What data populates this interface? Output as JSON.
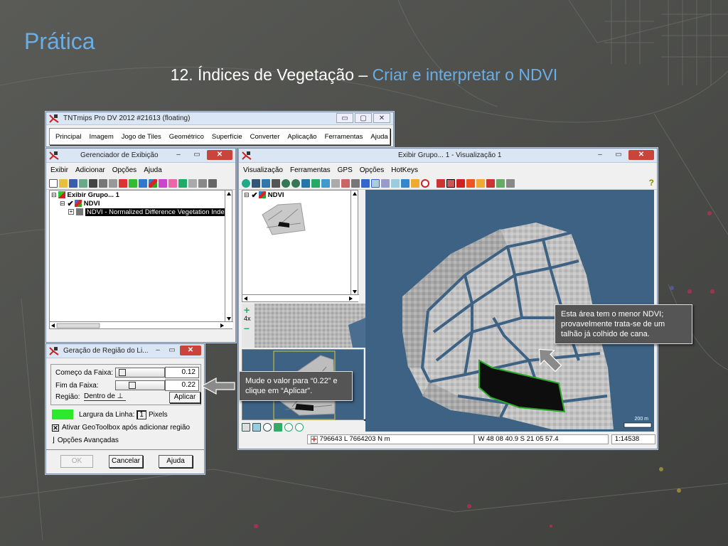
{
  "slide": {
    "title": "Prática",
    "subtitle_prefix": "12. Índices de Vegetação – ",
    "subtitle_accent": "Criar e interpretar o NDVI"
  },
  "tnt_window": {
    "title": "TNTmips Pro DV 2012  #21613 (floating)",
    "menu": [
      "Principal",
      "Imagem",
      "Jogo de Tiles",
      "Geométrico",
      "Superfície",
      "Converter",
      "Aplicação",
      "Ferramentas",
      "Ajuda"
    ]
  },
  "display_manager": {
    "title": "Gerenciador de Exibição",
    "menu": [
      "Exibir",
      "Adicionar",
      "Opções",
      "Ajuda"
    ],
    "tree": {
      "group": "Exibir Grupo... 1",
      "layer": "NDVI",
      "sublayer": "NDVI - Normalized Difference Vegetation Index"
    }
  },
  "view_window": {
    "title": "Exibir Grupo... 1 - Visualização 1",
    "menu": [
      "Visualização",
      "Ferramentas",
      "GPS",
      "Opções",
      "HotKeys"
    ],
    "legend_layer": "NDVI",
    "zoom_label": "4x",
    "scale_bar": "200 m",
    "status": {
      "coords": "796643 L  7664203 N m",
      "latlon": "W 48 08 40.9  S 21 05 57.4",
      "scale": "1:14538"
    }
  },
  "region_dialog": {
    "title": "Geração de Região do Li...",
    "start_label": "Começo da Faixa:",
    "start_value": "0.12",
    "end_label": "Fim da Faixa:",
    "end_value": "0.22",
    "region_label": "Região:",
    "region_select": "Dentro de",
    "apply": "Aplicar",
    "line_width_label": "Largura da Linha:",
    "line_width_value": "1",
    "pixels": "Pixels",
    "geotoolbox": "Ativar GeoToolbox após adicionar região",
    "advanced": "Opções Avançadas",
    "ok": "OK",
    "cancel": "Cancelar",
    "help": "Ajuda",
    "line_color": "#2ee82e"
  },
  "callouts": {
    "left": "Mude o valor para “0.22” e clique em “Aplicar”.",
    "right": "Esta área tem o menor NDVI; provavelmente trata-se de um talhão já colhido de cana."
  },
  "colors": {
    "title_blue": "#6aaee8",
    "water": "#3d6283"
  }
}
